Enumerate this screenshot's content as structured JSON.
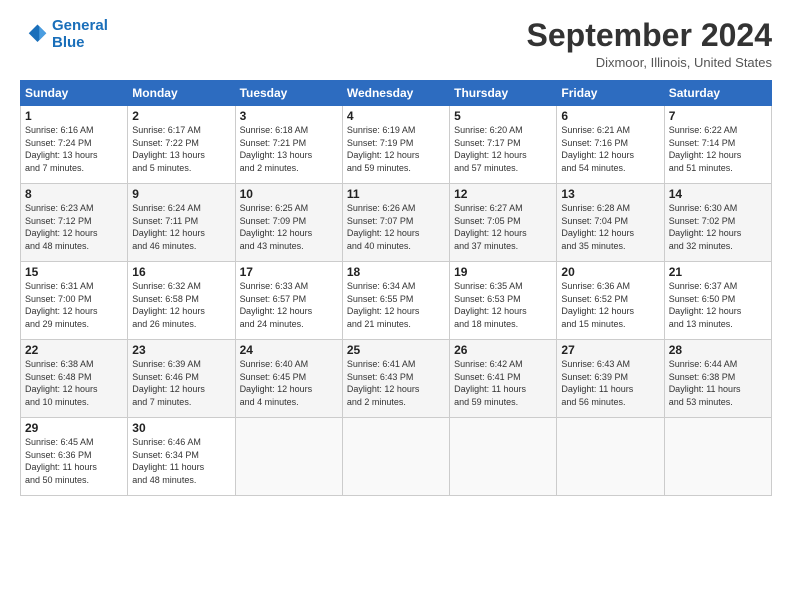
{
  "header": {
    "logo_line1": "General",
    "logo_line2": "Blue",
    "month": "September 2024",
    "location": "Dixmoor, Illinois, United States"
  },
  "weekdays": [
    "Sunday",
    "Monday",
    "Tuesday",
    "Wednesday",
    "Thursday",
    "Friday",
    "Saturday"
  ],
  "weeks": [
    [
      {
        "day": 1,
        "info": "Sunrise: 6:16 AM\nSunset: 7:24 PM\nDaylight: 13 hours\nand 7 minutes."
      },
      {
        "day": 2,
        "info": "Sunrise: 6:17 AM\nSunset: 7:22 PM\nDaylight: 13 hours\nand 5 minutes."
      },
      {
        "day": 3,
        "info": "Sunrise: 6:18 AM\nSunset: 7:21 PM\nDaylight: 13 hours\nand 2 minutes."
      },
      {
        "day": 4,
        "info": "Sunrise: 6:19 AM\nSunset: 7:19 PM\nDaylight: 12 hours\nand 59 minutes."
      },
      {
        "day": 5,
        "info": "Sunrise: 6:20 AM\nSunset: 7:17 PM\nDaylight: 12 hours\nand 57 minutes."
      },
      {
        "day": 6,
        "info": "Sunrise: 6:21 AM\nSunset: 7:16 PM\nDaylight: 12 hours\nand 54 minutes."
      },
      {
        "day": 7,
        "info": "Sunrise: 6:22 AM\nSunset: 7:14 PM\nDaylight: 12 hours\nand 51 minutes."
      }
    ],
    [
      {
        "day": 8,
        "info": "Sunrise: 6:23 AM\nSunset: 7:12 PM\nDaylight: 12 hours\nand 48 minutes."
      },
      {
        "day": 9,
        "info": "Sunrise: 6:24 AM\nSunset: 7:11 PM\nDaylight: 12 hours\nand 46 minutes."
      },
      {
        "day": 10,
        "info": "Sunrise: 6:25 AM\nSunset: 7:09 PM\nDaylight: 12 hours\nand 43 minutes."
      },
      {
        "day": 11,
        "info": "Sunrise: 6:26 AM\nSunset: 7:07 PM\nDaylight: 12 hours\nand 40 minutes."
      },
      {
        "day": 12,
        "info": "Sunrise: 6:27 AM\nSunset: 7:05 PM\nDaylight: 12 hours\nand 37 minutes."
      },
      {
        "day": 13,
        "info": "Sunrise: 6:28 AM\nSunset: 7:04 PM\nDaylight: 12 hours\nand 35 minutes."
      },
      {
        "day": 14,
        "info": "Sunrise: 6:30 AM\nSunset: 7:02 PM\nDaylight: 12 hours\nand 32 minutes."
      }
    ],
    [
      {
        "day": 15,
        "info": "Sunrise: 6:31 AM\nSunset: 7:00 PM\nDaylight: 12 hours\nand 29 minutes."
      },
      {
        "day": 16,
        "info": "Sunrise: 6:32 AM\nSunset: 6:58 PM\nDaylight: 12 hours\nand 26 minutes."
      },
      {
        "day": 17,
        "info": "Sunrise: 6:33 AM\nSunset: 6:57 PM\nDaylight: 12 hours\nand 24 minutes."
      },
      {
        "day": 18,
        "info": "Sunrise: 6:34 AM\nSunset: 6:55 PM\nDaylight: 12 hours\nand 21 minutes."
      },
      {
        "day": 19,
        "info": "Sunrise: 6:35 AM\nSunset: 6:53 PM\nDaylight: 12 hours\nand 18 minutes."
      },
      {
        "day": 20,
        "info": "Sunrise: 6:36 AM\nSunset: 6:52 PM\nDaylight: 12 hours\nand 15 minutes."
      },
      {
        "day": 21,
        "info": "Sunrise: 6:37 AM\nSunset: 6:50 PM\nDaylight: 12 hours\nand 13 minutes."
      }
    ],
    [
      {
        "day": 22,
        "info": "Sunrise: 6:38 AM\nSunset: 6:48 PM\nDaylight: 12 hours\nand 10 minutes."
      },
      {
        "day": 23,
        "info": "Sunrise: 6:39 AM\nSunset: 6:46 PM\nDaylight: 12 hours\nand 7 minutes."
      },
      {
        "day": 24,
        "info": "Sunrise: 6:40 AM\nSunset: 6:45 PM\nDaylight: 12 hours\nand 4 minutes."
      },
      {
        "day": 25,
        "info": "Sunrise: 6:41 AM\nSunset: 6:43 PM\nDaylight: 12 hours\nand 2 minutes."
      },
      {
        "day": 26,
        "info": "Sunrise: 6:42 AM\nSunset: 6:41 PM\nDaylight: 11 hours\nand 59 minutes."
      },
      {
        "day": 27,
        "info": "Sunrise: 6:43 AM\nSunset: 6:39 PM\nDaylight: 11 hours\nand 56 minutes."
      },
      {
        "day": 28,
        "info": "Sunrise: 6:44 AM\nSunset: 6:38 PM\nDaylight: 11 hours\nand 53 minutes."
      }
    ],
    [
      {
        "day": 29,
        "info": "Sunrise: 6:45 AM\nSunset: 6:36 PM\nDaylight: 11 hours\nand 50 minutes."
      },
      {
        "day": 30,
        "info": "Sunrise: 6:46 AM\nSunset: 6:34 PM\nDaylight: 11 hours\nand 48 minutes."
      },
      {
        "day": null
      },
      {
        "day": null
      },
      {
        "day": null
      },
      {
        "day": null
      },
      {
        "day": null
      }
    ]
  ]
}
